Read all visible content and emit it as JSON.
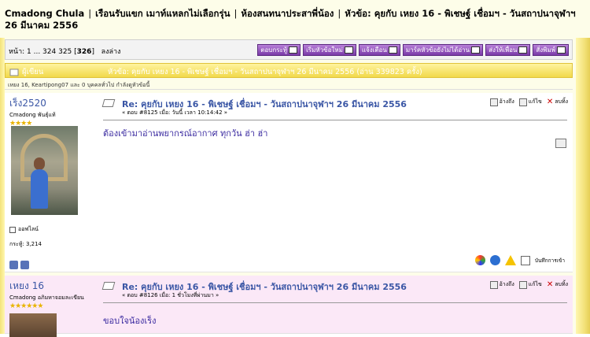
{
  "linktree": {
    "items": [
      "Cmadong Chula",
      "เรือนรับแขก เมาท์แหลกไม่เลือกรุ่น",
      "ห้องสนทนาประสาพี่น้อง",
      "หัวข้อ: คุยกับ เหยง 16 - พิเชษฐ์ เชื่อมฯ - วันสถาปนาจุฬาฯ 26 มีนาคม 2556"
    ],
    "separator": "|"
  },
  "pagebar": {
    "prefix": "หน้า: 1 ... 324 325 [",
    "current": "326",
    "suffix": "]",
    "goto_bottom": "ลงล่าง"
  },
  "buttons": [
    {
      "label": "ตอบกระทู้",
      "name": "reply-button"
    },
    {
      "label": "เริ่มหัวข้อใหม่",
      "name": "new-topic-button"
    },
    {
      "label": "แจ้งเตือน",
      "name": "notify-button"
    },
    {
      "label": "มาร์คหัวข้อยังไม่ได้อ่าน",
      "name": "mark-unread-button"
    },
    {
      "label": "ส่งให้เพื่อน",
      "name": "send-friend-button"
    },
    {
      "label": "สั่งพิมพ์",
      "name": "print-button"
    }
  ],
  "topic": {
    "author_label": "ผู้เขียน",
    "title": "หัวข้อ: คุยกับ เหยง 16 - พิเชษฐ์ เชื่อมฯ - วันสถาปนาจุฬาฯ 26 มีนาคม 2556  (อ่าน 339823 ครั้ง)",
    "viewers": "เหยง 16, Keartipong07 และ 0 บุคคลทั่วไป กำลังดูหัวข้อนี้"
  },
  "posts": [
    {
      "username": "เร็ง2520",
      "rank": "Cmadong พันธุ์แท้",
      "stars": "★★★★",
      "status": "ออฟไลน์",
      "postcount": "กระทู้: 3,214",
      "title": "Re: คุยกับ เหยง 16 - พิเชษฐ์ เชื่อมฯ - วันสถาปนาจุฬาฯ 26 มีนาคม 2556",
      "meta": "« ตอบ #8125 เมื่อ: วันนี้ เวลา 10:14:42 »",
      "body": "ต้องเข้ามาอ่านพยากรณ์อากาศ ทุกวัน ฮ่า ฮ่า",
      "quote": "อ้างถึง",
      "modify": "แก้ไข",
      "remove": "ลบทิ้ง",
      "log_ip": "บันทึกการเข้า"
    },
    {
      "username": "เหยง 16",
      "rank": "Cmadong อภิมหาจอมละเขียน",
      "stars": "★★★★★★",
      "title": "Re: คุยกับ เหยง 16 - พิเชษฐ์ เชื่อมฯ - วันสถาปนาจุฬาฯ 26 มีนาคม 2556",
      "meta": "« ตอบ #8126 เมื่อ: 1 ชั่วโมงที่ผ่านมา »",
      "body": "ขอบใจน้องเร็ง",
      "quote": "อ้างถึง",
      "modify": "แก้ไข",
      "remove": "ลบทิ้ง"
    }
  ]
}
